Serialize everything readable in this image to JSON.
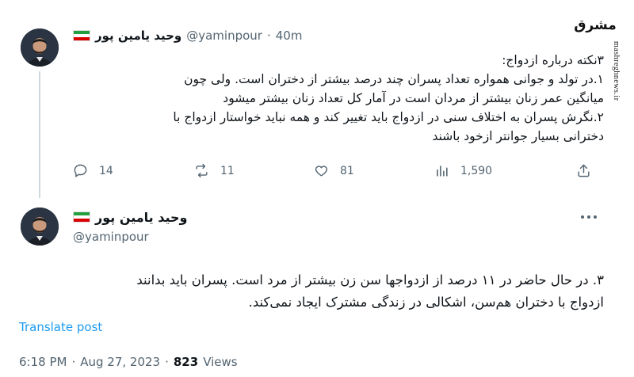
{
  "tweet1": {
    "display_name": "وحید یامین پور",
    "handle": "@yaminpour",
    "separator": "·",
    "time": "40m",
    "lines": [
      "۳نکته درباره ازدواج:",
      "۱.در تولد و جوانی همواره تعداد پسران چند درصد بیشتر از دختران است. ولی چون",
      "میانگین عمر زنان بیشتر از مردان است در آمار کل تعداد زنان بیشتر میشود",
      "۲.نگرش پسران به اختلاف سنی در ازدواج باید تغییر کند و همه نباید خواستار ازدواج با",
      "دخترانی بسیار جوانتر ازخود باشند"
    ],
    "stats": {
      "replies": "14",
      "reposts": "11",
      "likes": "81",
      "views": "1,590"
    }
  },
  "tweet2": {
    "display_name": "وحید یامین پور",
    "handle": "@yaminpour",
    "lines": [
      "۳. در حال حاضر در ۱۱ درصد از ازدواجها سن زن بیشتر از مرد است. پسران باید بدانند",
      "ازدواج با دختران هم‌سن، اشکالی در زندگی مشترک ایجاد نمی‌کند."
    ],
    "translate_label": "Translate post",
    "time": "6:18 PM",
    "separator": "·",
    "date": "Aug 27, 2023",
    "views_count": "823",
    "views_label": "Views"
  },
  "watermark": {
    "logo_text": "مشرق",
    "site": "mashreghnews.ir"
  },
  "icons": {
    "reply": "reply-icon",
    "repost": "repost-icon",
    "like": "heart-icon",
    "views": "views-icon",
    "share": "share-icon",
    "more": "more-icon",
    "flag": "iran-flag-icon"
  },
  "colors": {
    "accent": "#1d9bf0",
    "muted": "#536471",
    "text": "#0f1419",
    "thread_line": "#cfd9de"
  }
}
